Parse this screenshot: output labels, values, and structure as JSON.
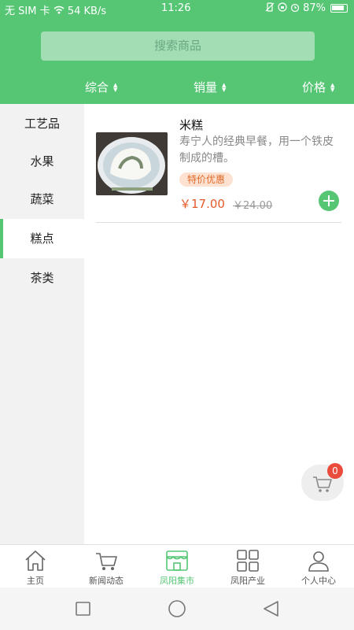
{
  "status_bar": {
    "left": "无 SIM 卡 ",
    "speed": "54 KB/s",
    "time": "11:26",
    "battery": "87%"
  },
  "search": {
    "placeholder": "搜索商品"
  },
  "sort": {
    "comprehensive": "综合",
    "sales": "销量",
    "price": "价格"
  },
  "categories": [
    {
      "label": "工艺品",
      "active": false
    },
    {
      "label": "水果",
      "active": false
    },
    {
      "label": "蔬菜",
      "active": false
    },
    {
      "label": "糕点",
      "active": true
    },
    {
      "label": "茶类",
      "active": false
    }
  ],
  "products": [
    {
      "name": "米糕",
      "description": "寿宁人的经典早餐，用一个铁皮制成的槽。",
      "badge": "特价优惠",
      "price": "￥17.00",
      "original_price": "￥24.00"
    }
  ],
  "cart": {
    "count": "0"
  },
  "tabs": [
    {
      "label": "主页",
      "icon": "home-icon",
      "active": false
    },
    {
      "label": "新闻动态",
      "icon": "cart-icon",
      "active": false
    },
    {
      "label": "凤阳集市",
      "icon": "store-icon",
      "active": true
    },
    {
      "label": "凤阳产业",
      "icon": "grid-icon",
      "active": false
    },
    {
      "label": "个人中心",
      "icon": "person-icon",
      "active": false
    }
  ],
  "colors": {
    "primary": "#56c675",
    "price": "#e55a2a",
    "badge_bg": "#fde2d1",
    "badge_text": "#e06a2b",
    "cart_badge": "#e94b3c"
  }
}
